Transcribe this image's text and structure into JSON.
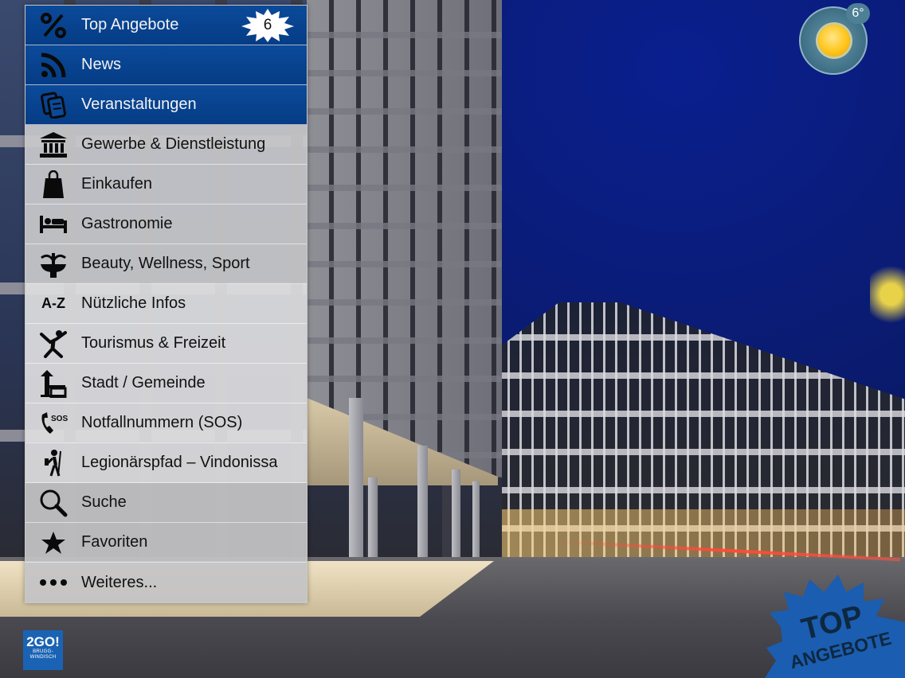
{
  "menu": {
    "items": [
      {
        "label": "Top Angebote",
        "icon": "percent-icon",
        "badge": "6"
      },
      {
        "label": "News",
        "icon": "rss-icon"
      },
      {
        "label": "Veranstaltungen",
        "icon": "events-icon"
      },
      {
        "label": "Gewerbe & Dienstleistung",
        "icon": "bank-icon"
      },
      {
        "label": "Einkaufen",
        "icon": "shopping-bag-icon"
      },
      {
        "label": "Gastronomie",
        "icon": "bed-icon"
      },
      {
        "label": "Beauty, Wellness, Sport",
        "icon": "fountain-icon"
      },
      {
        "label": "Nützliche Infos",
        "icon": "a-z-icon",
        "icon_text": "A-Z"
      },
      {
        "label": "Tourismus & Freizeit",
        "icon": "person-jumping-icon"
      },
      {
        "label": "Stadt / Gemeinde",
        "icon": "town-hall-icon"
      },
      {
        "label": "Notfallnummern (SOS)",
        "icon": "sos-phone-icon",
        "icon_text": "SOS"
      },
      {
        "label": "Legionärspfad – Vindonissa",
        "icon": "legionary-icon"
      },
      {
        "label": "Suche",
        "icon": "search-icon"
      },
      {
        "label": "Favoriten",
        "icon": "star-icon"
      },
      {
        "label": "Weiteres...",
        "icon": "more-dots-icon"
      }
    ]
  },
  "weather": {
    "temperature": "6°",
    "icon": "sun-icon"
  },
  "logo": {
    "main": "2GO!",
    "line1": "BRUGG-",
    "line2": "WINDISCH"
  },
  "promo": {
    "line1": "TOP",
    "line2": "ANGEBOTE"
  },
  "colors": {
    "menu_blue": "#053c85",
    "menu_gray": "#c8c8ca",
    "logo_blue": "#1a63b4",
    "promo_blue": "#1b5db0"
  }
}
